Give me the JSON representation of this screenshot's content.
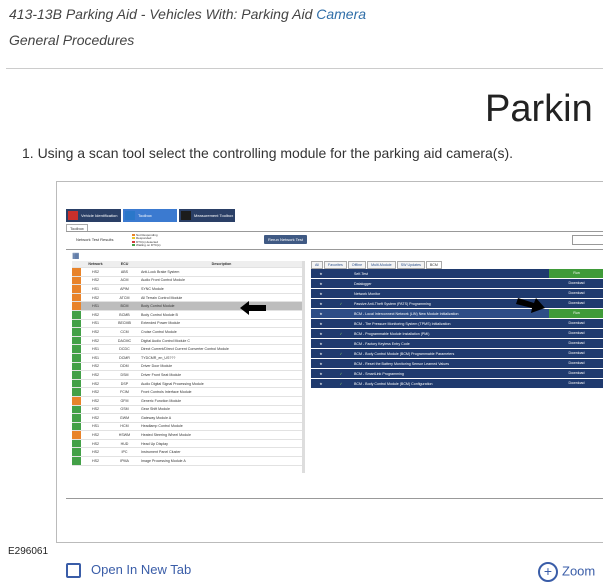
{
  "header": {
    "title_text": "413-13B Parking Aid - Vehicles With: Parking Aid ",
    "title_link": "Camera",
    "subtitle": "General Procedures"
  },
  "section_heading": "Parkin",
  "step_text": "1. Using a scan tool select the controlling module for the parking aid camera(s).",
  "figure_label": "E296061",
  "open_tab_label": "Open In New Tab",
  "zoom_label": "Zoom",
  "scan_tool": {
    "toolbar": [
      {
        "label": "Vehicle Identification",
        "color": "#c9302c"
      },
      {
        "label": "Toolbox",
        "color": "#2a77c9"
      },
      {
        "label": "Measurement Toolbox",
        "color": "#1c1c1c"
      }
    ],
    "tab_label": "Toolbox",
    "results_label": "Network Test Results",
    "legend": [
      "Not Responding",
      "Responded",
      "DTC(s) detected",
      "Waiting on DTC(s)"
    ],
    "legend_colors": [
      "#e8832a",
      "#e8c62a",
      "#d23b3b",
      "#43a047"
    ],
    "rerun_label": "Rerun Network Test",
    "columns": [
      "Network",
      "ECU",
      "Description"
    ],
    "modules": [
      {
        "network": "HS2",
        "ecu": "ABS",
        "desc": "Anti-Lock Brake System",
        "status": "#e8832a"
      },
      {
        "network": "HS2",
        "ecu": "ACM",
        "desc": "Audio Front Control Module",
        "status": "#e8832a"
      },
      {
        "network": "HS1",
        "ecu": "APIM",
        "desc": "SYNC Module",
        "status": "#e8832a"
      },
      {
        "network": "HS2",
        "ecu": "ATCM",
        "desc": "All Terrain Control Module",
        "status": "#e8832a"
      },
      {
        "network": "HS1",
        "ecu": "BCM",
        "desc": "Body Control Module",
        "status": "#e8832a",
        "selected": true
      },
      {
        "network": "HS2",
        "ecu": "BCMB",
        "desc": "Body Control Module B",
        "status": "#43a047"
      },
      {
        "network": "HS1",
        "ecu": "BECMB",
        "desc": "Extended Power Module",
        "status": "#43a047"
      },
      {
        "network": "HS2",
        "ecu": "CCM",
        "desc": "Cruise Control Module",
        "status": "#43a047"
      },
      {
        "network": "HS2",
        "ecu": "DACMC",
        "desc": "Digital Audio Control Module C",
        "status": "#43a047"
      },
      {
        "network": "HS1",
        "ecu": "DCDC",
        "desc": "Direct Current/Direct Current Converter Control Module",
        "status": "#43a047"
      },
      {
        "network": "HS1",
        "ecu": "DCMR",
        "desc": "TYDCMR_en_US???",
        "status": "#43a047"
      },
      {
        "network": "HS2",
        "ecu": "DDM",
        "desc": "Driver Door Module",
        "status": "#43a047"
      },
      {
        "network": "HS2",
        "ecu": "DSM",
        "desc": "Driver Front Seat Module",
        "status": "#43a047"
      },
      {
        "network": "HS2",
        "ecu": "DSP",
        "desc": "Audio Digital Signal Processing Module",
        "status": "#43a047"
      },
      {
        "network": "HS2",
        "ecu": "FCIM",
        "desc": "Front Controls Interface Module",
        "status": "#43a047"
      },
      {
        "network": "HS2",
        "ecu": "GFM",
        "desc": "Generic Function Module",
        "status": "#e8832a"
      },
      {
        "network": "HS2",
        "ecu": "GSM",
        "desc": "Gear Shift Module",
        "status": "#43a047"
      },
      {
        "network": "HS2",
        "ecu": "GWM",
        "desc": "Gateway Module A",
        "status": "#43a047"
      },
      {
        "network": "HS1",
        "ecu": "HCM",
        "desc": "Headlamp Control Module",
        "status": "#43a047"
      },
      {
        "network": "HS2",
        "ecu": "HSWM",
        "desc": "Heated Steering Wheel Module",
        "status": "#e8832a"
      },
      {
        "network": "HS2",
        "ecu": "HUD",
        "desc": "Head Up Display",
        "status": "#43a047"
      },
      {
        "network": "HS2",
        "ecu": "IPC",
        "desc": "Instrument Panel Cluster",
        "status": "#43a047"
      },
      {
        "network": "HS2",
        "ecu": "IPMA",
        "desc": "Image Processing Module A",
        "status": "#43a047"
      }
    ],
    "right_tabs": [
      "All",
      "Favorites",
      "Offline",
      "Multi-Module",
      "SW Updates",
      "BCM"
    ],
    "functions": [
      {
        "name": "Self-Test",
        "action": "Run",
        "check": false,
        "run": true
      },
      {
        "name": "Datalogger",
        "action": "Download",
        "check": false
      },
      {
        "name": "Network Monitor",
        "action": "Download",
        "check": false
      },
      {
        "name": "Passive Anti-Theft System (PATS) Programming",
        "action": "Download",
        "check": true
      },
      {
        "name": "BCM - Local Interconnect Network (LIN) New Module Initialization",
        "action": "Run",
        "check": false,
        "run": true,
        "highlight": true
      },
      {
        "name": "BCM - Tire Pressure Monitoring System (TPMS) Initialization",
        "action": "Download",
        "check": false
      },
      {
        "name": "BCM - Programmable Module Installation (PMI)",
        "action": "Download",
        "check": true
      },
      {
        "name": "BCM - Factory Keyless Entry Code",
        "action": "Download",
        "check": false
      },
      {
        "name": "BCM - Body Control Module (BCM) Programmable Parameters",
        "action": "Download",
        "check": true
      },
      {
        "name": "BCM - Reset the Battery Monitoring Sensor Learned Values",
        "action": "Download",
        "check": false
      },
      {
        "name": "BCM - SmartLink Programming",
        "action": "Download",
        "check": true
      },
      {
        "name": "BCM - Body Control Module (BCM) Configuration",
        "action": "Download",
        "check": true
      }
    ]
  }
}
